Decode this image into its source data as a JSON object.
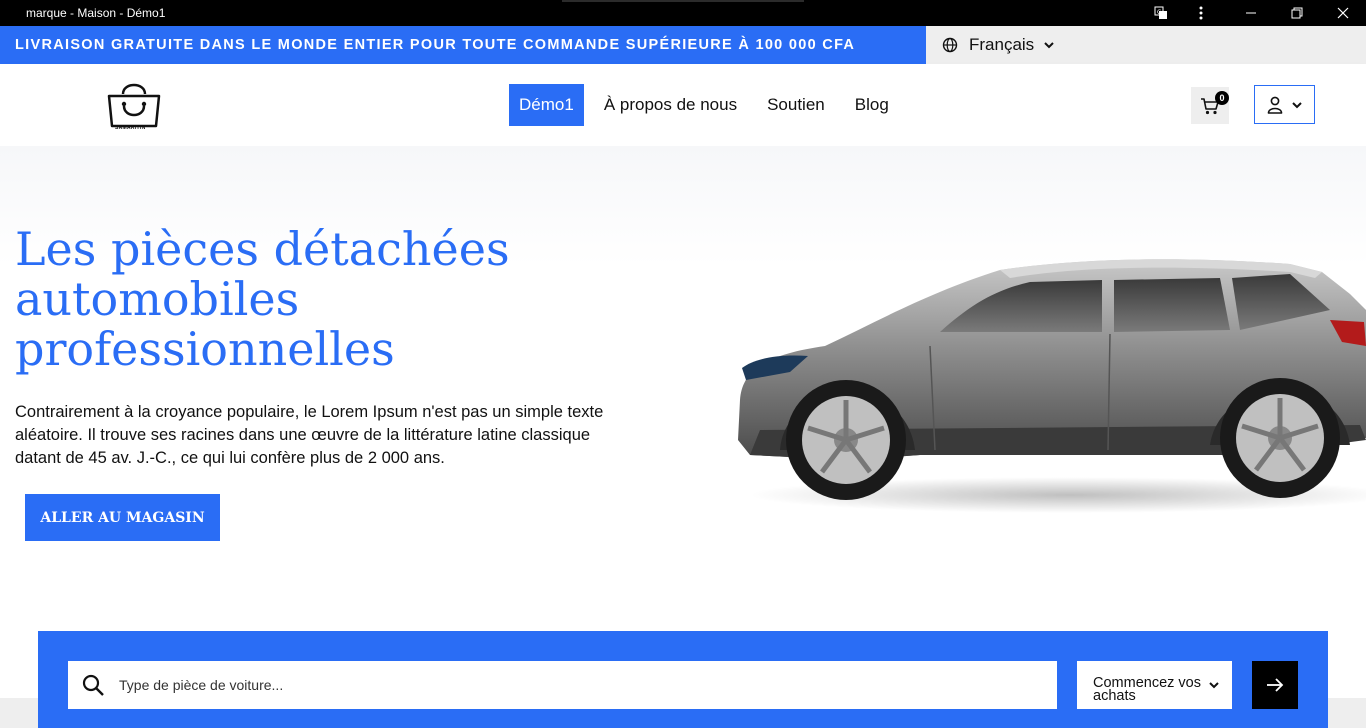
{
  "window": {
    "title": "marque - Maison - Démo1"
  },
  "promo": {
    "text": "LIVRAISON GRATUITE DANS LE MONDE ENTIER POUR TOUTE COMMANDE SUPÉRIEURE À 100 000 CFA"
  },
  "language": {
    "selected": "Français"
  },
  "logo": {
    "text": "SAMARITIN"
  },
  "nav": {
    "items": [
      "Démo1",
      "À propos de nous",
      "Soutien",
      "Blog"
    ],
    "active_index": 0
  },
  "cart": {
    "count": "0"
  },
  "hero": {
    "title": "Les pièces détachées automobiles professionnelles",
    "text": "Contrairement à la croyance populaire, le Lorem Ipsum n'est pas un simple texte aléatoire. Il trouve ses racines dans une œuvre de la littérature latine classique datant de 45 av. J.-C., ce qui lui confère plus de 2 000 ans.",
    "cta": "ALLER AU MAGASIN"
  },
  "search": {
    "placeholder": "Type de pièce de voiture...",
    "select_label": "Commencez vos achats"
  },
  "colors": {
    "accent": "#2a6df5",
    "light_gray": "#eeeeee",
    "black": "#000000"
  }
}
